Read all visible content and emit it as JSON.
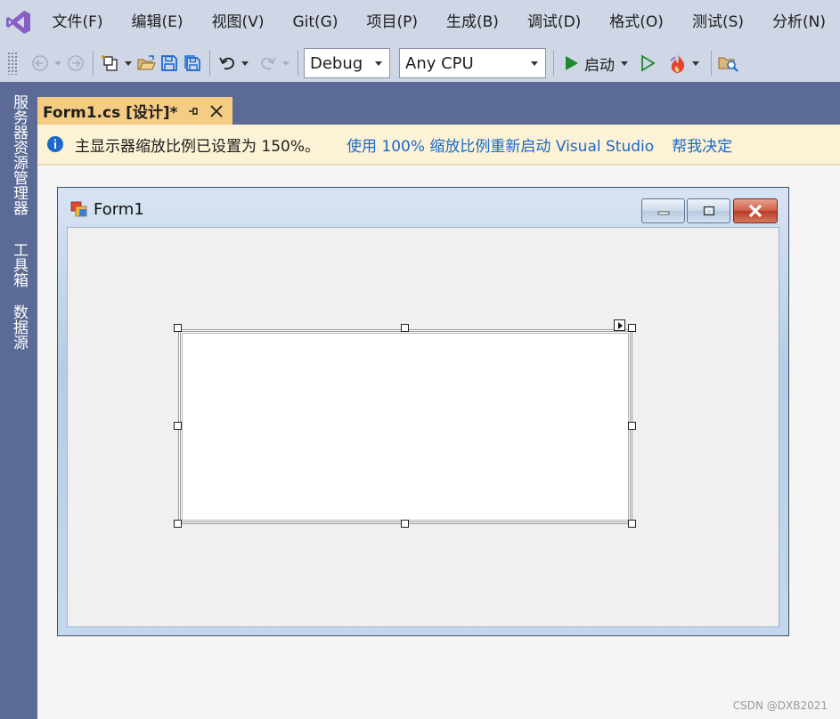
{
  "menu": {
    "items": [
      "文件(F)",
      "编辑(E)",
      "视图(V)",
      "Git(G)",
      "项目(P)",
      "生成(B)",
      "调试(D)",
      "格式(O)",
      "测试(S)",
      "分析(N)"
    ]
  },
  "toolbar": {
    "configuration": "Debug",
    "platform": "Any CPU",
    "start_label": "启动"
  },
  "sidebar": {
    "tabs": [
      "服务器资源管理器",
      "工具箱",
      "数据源"
    ]
  },
  "document": {
    "tab_title": "Form1.cs [设计]*"
  },
  "infobar": {
    "message": "主显示器缩放比例已设置为 150%。",
    "restart_link": "使用 100% 缩放比例重新启动 Visual Studio",
    "decide_link": "帮我决定"
  },
  "form": {
    "title": "Form1"
  },
  "watermark": "CSDN @DXB2021",
  "colors": {
    "menubar_bg": "#cfd6e5",
    "sidebar_bg": "#5b6b95",
    "active_tab_bg": "#f5cc84",
    "infobar_bg": "#fcf2d5",
    "link": "#1b6ac9",
    "vs_purple": "#865fc5",
    "start_green": "#1e8a2e",
    "close_red": "#c4442e"
  },
  "icons": {
    "logo": "visual-studio-logo",
    "back": "navigate-back-icon",
    "forward": "navigate-forward-icon",
    "new_item": "new-item-icon",
    "open": "open-folder-icon",
    "save": "save-icon",
    "save_all": "save-all-icon",
    "undo": "undo-icon",
    "redo": "redo-icon",
    "start": "play-icon",
    "start_without_debug": "play-outline-icon",
    "hot_reload": "hot-reload-icon",
    "find": "find-in-files-icon",
    "info": "info-icon",
    "pin": "pin-icon",
    "close": "close-icon"
  }
}
